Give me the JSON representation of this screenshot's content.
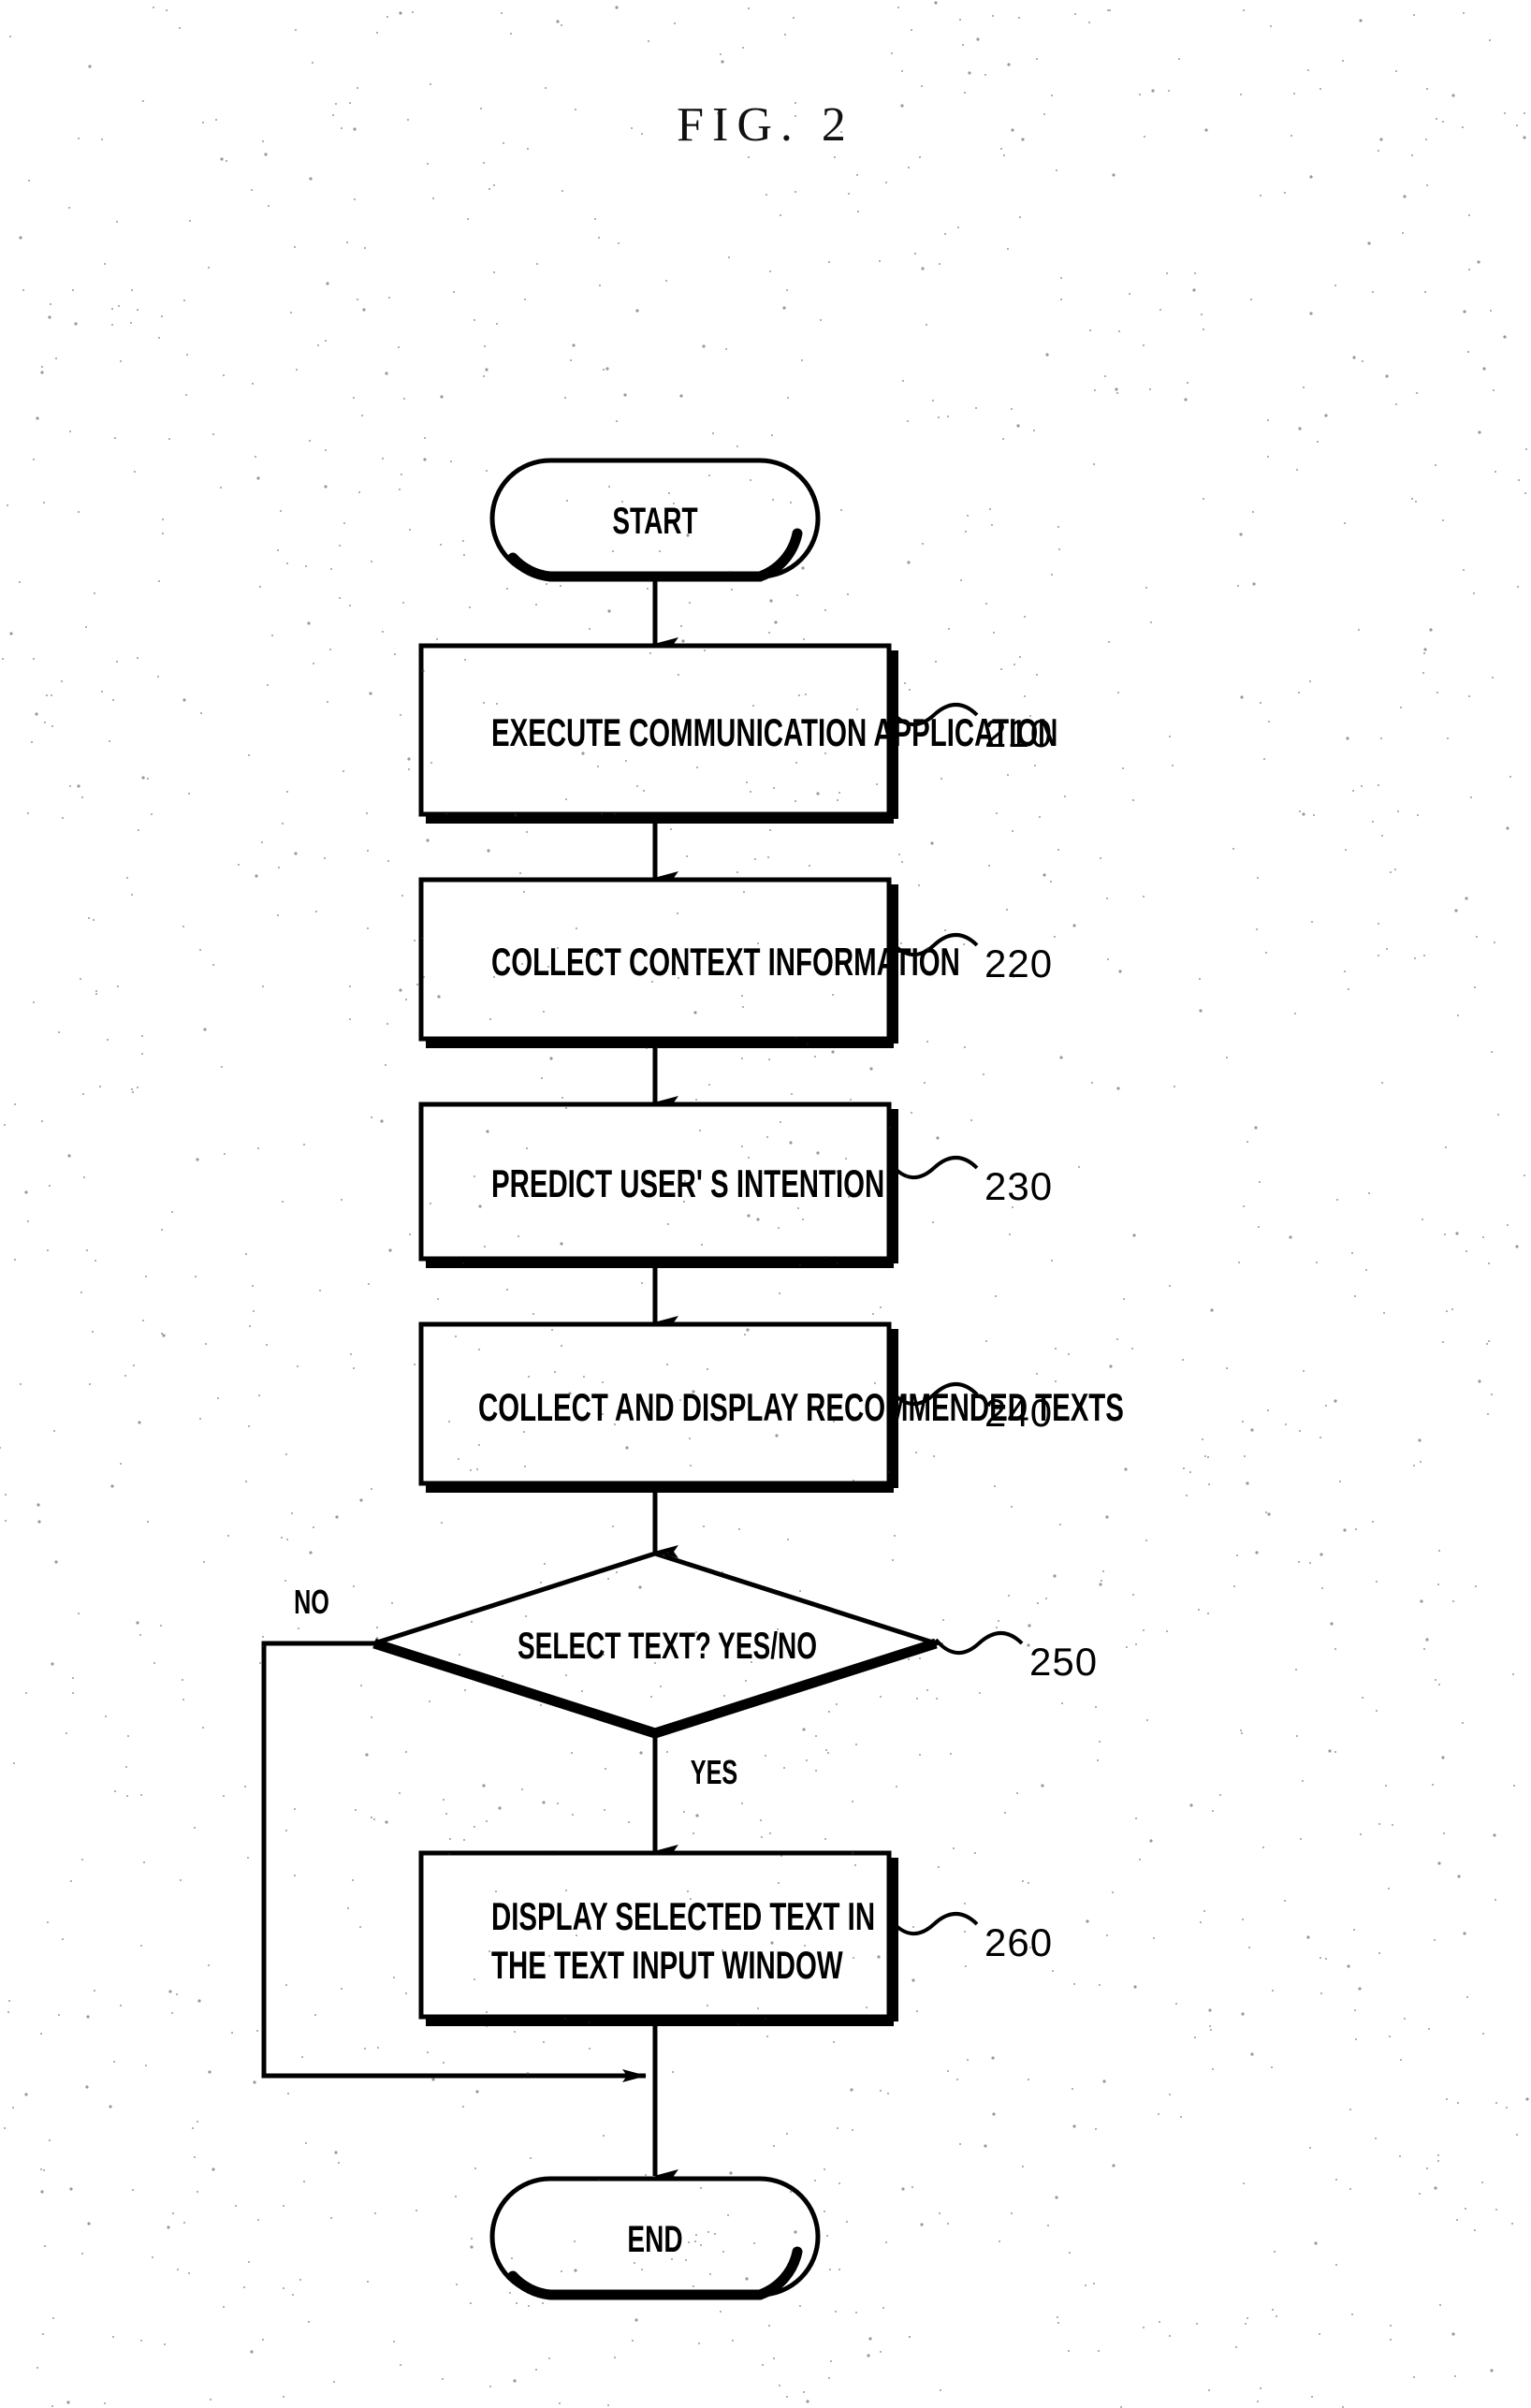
{
  "figure": {
    "title": "FIG. 2",
    "type": "flowchart",
    "ink_color": "#000000",
    "paper_color": "#ffffff"
  },
  "nodes": {
    "start": {
      "label": "START",
      "shape": "terminator"
    },
    "step_210": {
      "label": "EXECUTE COMMUNICATION APPLICATION",
      "shape": "process",
      "ref": "210"
    },
    "step_220": {
      "label": "COLLECT CONTEXT INFORMATION",
      "shape": "process",
      "ref": "220"
    },
    "step_230": {
      "label": "PREDICT USER' S INTENTION",
      "shape": "process",
      "ref": "230"
    },
    "step_240": {
      "label": "COLLECT AND DISPLAY RECOMMENDED TEXTS",
      "shape": "process",
      "ref": "240"
    },
    "step_250": {
      "label": "SELECT TEXT? YES/NO",
      "shape": "decision",
      "ref": "250"
    },
    "step_260": {
      "line1": "DISPLAY SELECTED TEXT IN",
      "line2": "THE TEXT INPUT WINDOW",
      "shape": "process",
      "ref": "260"
    },
    "end": {
      "label": "END",
      "shape": "terminator"
    }
  },
  "branches": {
    "no_label": "NO",
    "yes_label": "YES"
  },
  "references": {
    "r210": "210",
    "r220": "220",
    "r230": "230",
    "r240": "240",
    "r250": "250",
    "r260": "260"
  }
}
